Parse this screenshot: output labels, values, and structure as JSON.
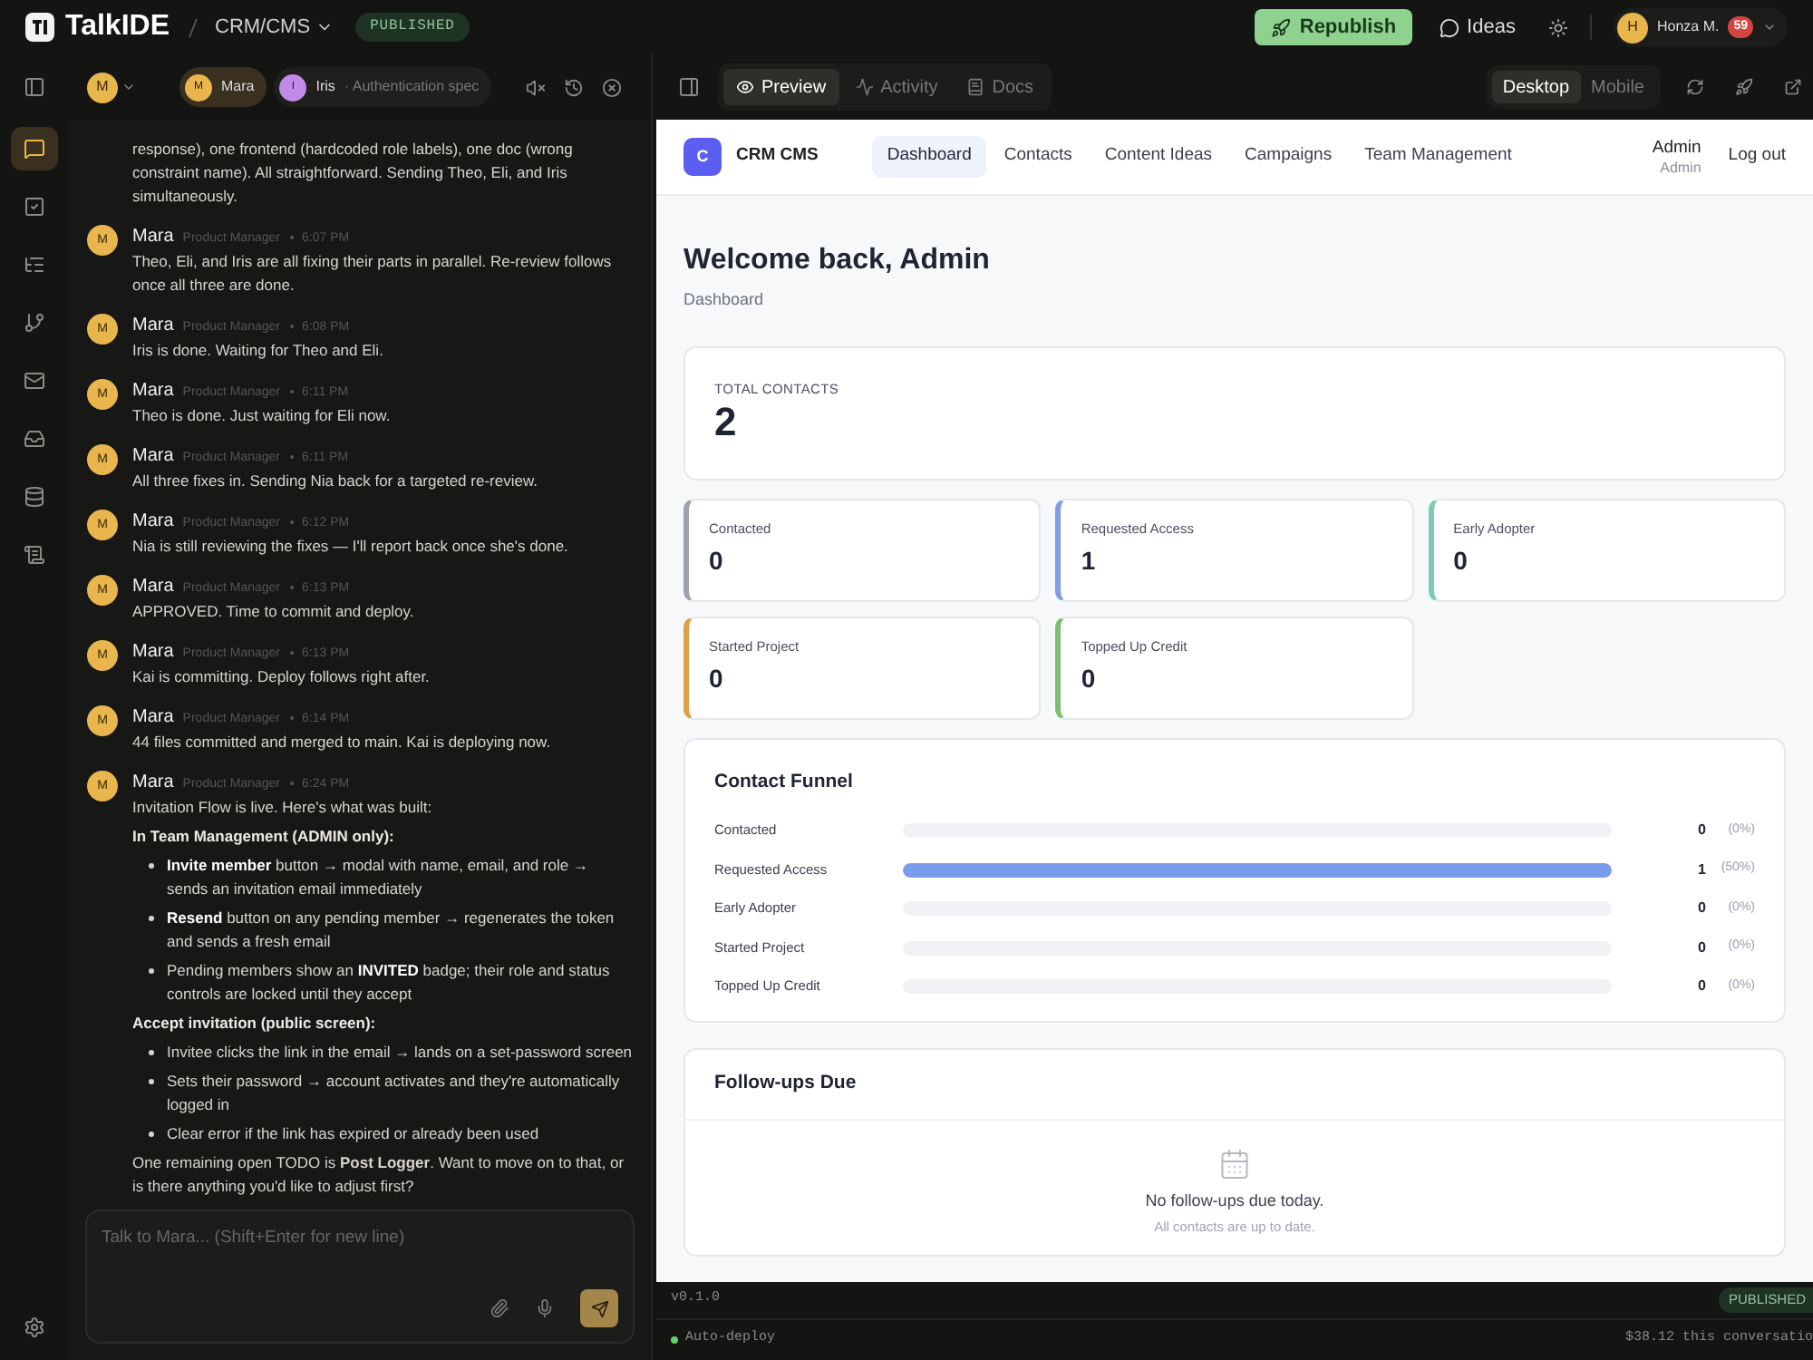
{
  "app": {
    "name": "TalkIDE",
    "project": "CRM/CMS",
    "status": "PUBLISHED"
  },
  "top_actions": {
    "republish": "Republish",
    "ideas": "Ideas",
    "user": {
      "initial": "H",
      "name": "Honza M.",
      "badge": "59"
    }
  },
  "chat_toolbar": {
    "agent_initial": "M",
    "agents": [
      {
        "initial": "M",
        "name": "Mara",
        "color": "#e8b64c",
        "selected": true
      },
      {
        "initial": "I",
        "name": "Iris",
        "detail": "· Authentication spec",
        "color": "#c08ae8",
        "selected": false
      }
    ]
  },
  "rail": [
    {
      "selected": true
    },
    {
      "selected": false
    },
    {
      "selected": false
    },
    {
      "selected": false
    },
    {
      "selected": false
    },
    {
      "selected": false
    },
    {
      "selected": false
    },
    {
      "selected": false
    }
  ],
  "messages": [
    {
      "kind": "continuation",
      "blocks": [
        {
          "kind": "p",
          "text": "response), one frontend (hardcoded role labels), one doc (wrong constraint name). All straightforward. Sending Theo, Eli, and Iris simultaneously."
        }
      ]
    },
    {
      "kind": "message",
      "initial": "M",
      "author": "Mara",
      "role": "Product Manager",
      "time": "6:07 PM",
      "blocks": [
        {
          "kind": "p",
          "text": "Theo, Eli, and Iris are all fixing their parts in parallel. Re-review follows once all three are done."
        }
      ]
    },
    {
      "kind": "message",
      "initial": "M",
      "author": "Mara",
      "role": "Product Manager",
      "time": "6:08 PM",
      "blocks": [
        {
          "kind": "p",
          "text": "Iris is done. Waiting for Theo and Eli."
        }
      ]
    },
    {
      "kind": "message",
      "initial": "M",
      "author": "Mara",
      "role": "Product Manager",
      "time": "6:11 PM",
      "blocks": [
        {
          "kind": "p",
          "text": "Theo is done. Just waiting for Eli now."
        }
      ]
    },
    {
      "kind": "message",
      "initial": "M",
      "author": "Mara",
      "role": "Product Manager",
      "time": "6:11 PM",
      "blocks": [
        {
          "kind": "p",
          "text": "All three fixes in. Sending Nia back for a targeted re-review."
        }
      ]
    },
    {
      "kind": "message",
      "initial": "M",
      "author": "Mara",
      "role": "Product Manager",
      "time": "6:12 PM",
      "blocks": [
        {
          "kind": "p",
          "text": "Nia is still reviewing the fixes — I'll report back once she's done."
        }
      ]
    },
    {
      "kind": "message",
      "initial": "M",
      "author": "Mara",
      "role": "Product Manager",
      "time": "6:13 PM",
      "blocks": [
        {
          "kind": "p",
          "text": "APPROVED. Time to commit and deploy."
        }
      ]
    },
    {
      "kind": "message",
      "initial": "M",
      "author": "Mara",
      "role": "Product Manager",
      "time": "6:13 PM",
      "blocks": [
        {
          "kind": "p",
          "text": "Kai is committing. Deploy follows right after."
        }
      ]
    },
    {
      "kind": "message",
      "initial": "M",
      "author": "Mara",
      "role": "Product Manager",
      "time": "6:14 PM",
      "blocks": [
        {
          "kind": "p",
          "text": "44 files committed and merged to main. Kai is deploying now."
        }
      ]
    },
    {
      "kind": "message",
      "initial": "M",
      "author": "Mara",
      "role": "Product Manager",
      "time": "6:24 PM",
      "blocks": [
        {
          "kind": "p",
          "text": "Invitation Flow is live. Here's what was built:"
        },
        {
          "kind": "heading",
          "text": "In Team Management (ADMIN only):"
        },
        {
          "kind": "bullet",
          "text": "**Invite member** button → modal with name, email, and role → sends an invitation email immediately"
        },
        {
          "kind": "bullet",
          "text": "**Resend** button on any pending member → regenerates the token and sends a fresh email"
        },
        {
          "kind": "bullet",
          "text": "Pending members show an **INVITED** badge; their role and status controls are locked until they accept"
        },
        {
          "kind": "heading",
          "text": "Accept invitation (public screen):"
        },
        {
          "kind": "bullet",
          "text": "Invitee clicks the link in the email → lands on a set-password screen"
        },
        {
          "kind": "bullet",
          "text": "Sets their password → account activates and they're automatically logged in"
        },
        {
          "kind": "bullet",
          "text": "Clear error if the link has expired or already been used"
        },
        {
          "kind": "p",
          "text": "One remaining open TODO is **Post Logger**. Want to move on to that, or is there anything you'd like to adjust first?"
        }
      ]
    }
  ],
  "composer": {
    "placeholder": "Talk to Mara... (Shift+Enter for new line)"
  },
  "preview_tabs": [
    {
      "label": "Preview",
      "selected": true
    },
    {
      "label": "Activity",
      "selected": false
    },
    {
      "label": "Docs",
      "selected": false
    }
  ],
  "device_toggle": [
    {
      "label": "Desktop",
      "selected": true
    },
    {
      "label": "Mobile",
      "selected": false
    }
  ],
  "site": {
    "logo": "C",
    "name": "CRM CMS",
    "nav": [
      {
        "label": "Dashboard",
        "selected": true
      },
      {
        "label": "Contacts",
        "selected": false
      },
      {
        "label": "Content Ideas",
        "selected": false
      },
      {
        "label": "Campaigns",
        "selected": false
      },
      {
        "label": "Team Management",
        "selected": false
      }
    ],
    "user": {
      "name": "Admin",
      "role": "Admin"
    },
    "logout": "Log out",
    "title": "Welcome back, Admin",
    "subtitle": "Dashboard",
    "total": {
      "label": "TOTAL CONTACTS",
      "value": "2"
    },
    "stats": [
      {
        "label": "Contacted",
        "value": "0",
        "color": "#9ca3af"
      },
      {
        "label": "Requested Access",
        "value": "1",
        "color": "#7f9ce6"
      },
      {
        "label": "Early Adopter",
        "value": "0",
        "color": "#7ccbb4"
      },
      {
        "label": "Started Project",
        "value": "0",
        "color": "#e0a043"
      },
      {
        "label": "Topped Up Credit",
        "value": "0",
        "color": "#7dbf6e"
      }
    ],
    "funnel": {
      "title": "Contact Funnel",
      "rows": [
        {
          "label": "Contacted",
          "level": 0,
          "count": "0",
          "percent": "(0%)"
        },
        {
          "label": "Requested Access",
          "level": 1,
          "count": "1",
          "percent": "(50%)"
        },
        {
          "label": "Early Adopter",
          "level": 0,
          "count": "0",
          "percent": "(0%)"
        },
        {
          "label": "Started Project",
          "level": 0,
          "count": "0",
          "percent": "(0%)"
        },
        {
          "label": "Topped Up Credit",
          "level": 0,
          "count": "0",
          "percent": "(0%)"
        }
      ]
    },
    "followups": {
      "title": "Follow-ups Due",
      "empty": "No follow-ups due today.",
      "hint": "All contacts are up to date."
    }
  },
  "status_bar": {
    "version": "v0.1.0",
    "badge": "PUBLISHED",
    "auto_deploy": {
      "label": "Auto-deploy",
      "on": true
    },
    "cost": "$38.12 this conversatio"
  }
}
